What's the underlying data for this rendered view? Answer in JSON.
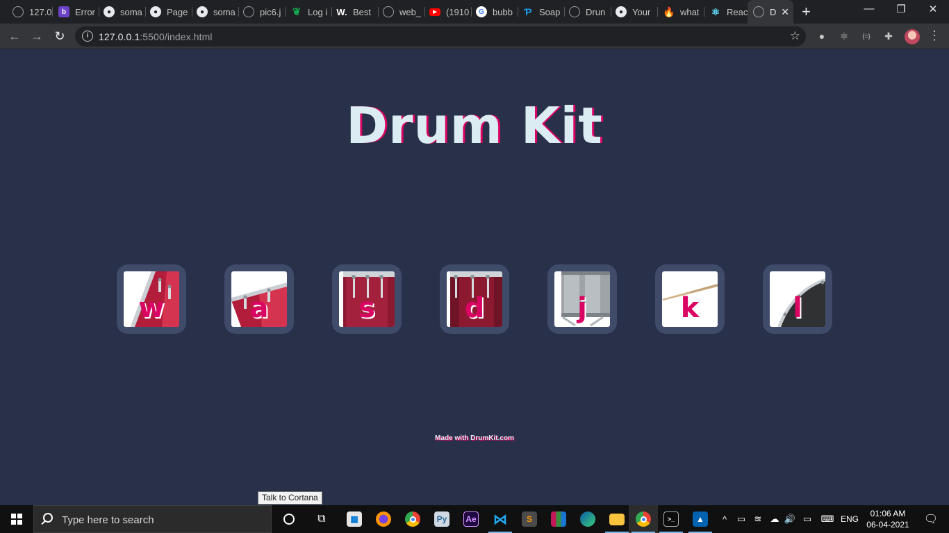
{
  "browser": {
    "tabs": [
      {
        "title": "127.0",
        "favicon": "globe-icon"
      },
      {
        "title": "Error",
        "favicon": "b-brand-icon"
      },
      {
        "title": "soma",
        "favicon": "github-icon"
      },
      {
        "title": "Page",
        "favicon": "github-icon"
      },
      {
        "title": "soma",
        "favicon": "github-icon"
      },
      {
        "title": "pic6.j",
        "favicon": "globe-icon"
      },
      {
        "title": "Log i",
        "favicon": "leaf-icon"
      },
      {
        "title": "Best",
        "favicon": "w-brand-icon"
      },
      {
        "title": "web_",
        "favicon": "globe-icon"
      },
      {
        "title": "(1910",
        "favicon": "youtube-icon"
      },
      {
        "title": "bubb",
        "favicon": "google-icon"
      },
      {
        "title": "Soap",
        "favicon": "p-brand-icon"
      },
      {
        "title": "Drun",
        "favicon": "globe-icon"
      },
      {
        "title": "Your",
        "favicon": "github-icon"
      },
      {
        "title": "what",
        "favicon": "fire-icon"
      },
      {
        "title": "Reac",
        "favicon": "react-icon"
      },
      {
        "title": "D",
        "favicon": "globe-icon"
      }
    ],
    "address": {
      "host": "127.0.0.1",
      "path": ":5500/index.html"
    }
  },
  "page": {
    "title": "Drum Kit",
    "drums": [
      {
        "key": "w",
        "instrument": "tom-1"
      },
      {
        "key": "a",
        "instrument": "tom-2"
      },
      {
        "key": "s",
        "instrument": "tom-3"
      },
      {
        "key": "d",
        "instrument": "tom-4"
      },
      {
        "key": "j",
        "instrument": "snare"
      },
      {
        "key": "k",
        "instrument": "crash"
      },
      {
        "key": "l",
        "instrument": "kick"
      }
    ],
    "footer": "Made with DrumKit.com"
  },
  "taskbar": {
    "tooltip": "Talk to Cortana",
    "search_placeholder": "Type here to search",
    "language": "ENG",
    "time": "01:06 AM",
    "date": "06-04-2021"
  },
  "colors": {
    "background": "#283149",
    "drum_frame": "#404b69",
    "accent": "#DA0463",
    "title": "#DBEDF3"
  }
}
